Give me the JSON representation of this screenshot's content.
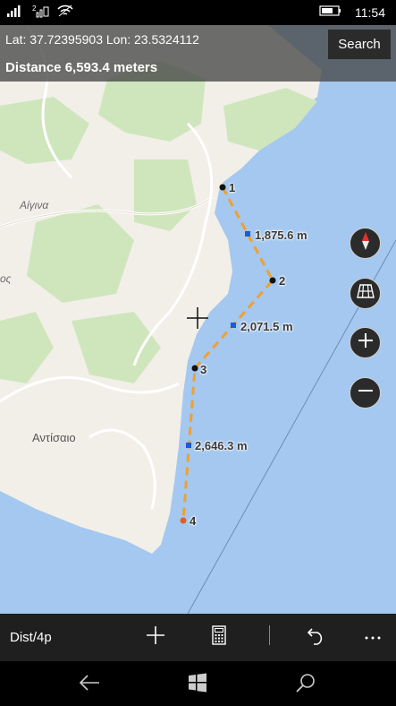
{
  "status_bar": {
    "time": "11:54",
    "icons": [
      "signal-icon",
      "sim2-signal-icon",
      "wifi-icon",
      "battery-icon"
    ]
  },
  "header": {
    "coords": "Lat: 37.72395903 Lon: 23.5324112",
    "distance": "Distance 6,593.4 meters",
    "search_label": "Search"
  },
  "map": {
    "labels": {
      "aigina": "Αίγινα",
      "antisaio": "Αντίσαιο",
      "partial_left": "ος"
    },
    "route": {
      "points": [
        "1",
        "2",
        "3",
        "4"
      ],
      "segments": [
        "1,875.6 m",
        "2,071.5 m",
        "2,646.3 m"
      ]
    },
    "controls": [
      "compass-icon",
      "map-type-icon",
      "zoom-in-icon",
      "zoom-out-icon"
    ],
    "colors": {
      "water": "#a4c8ef",
      "land": "#f2efe9",
      "green": "#cfe6bd",
      "route": "#f0a030",
      "segment_marker": "#1e5ad6",
      "end_marker": "#e06020"
    }
  },
  "app_bar": {
    "mode_label": "Dist/4p",
    "buttons": [
      "add-icon",
      "calculator-icon",
      "undo-icon",
      "more-icon"
    ]
  },
  "nav_bar": {
    "buttons": [
      "back-icon",
      "windows-icon",
      "search-icon"
    ]
  }
}
